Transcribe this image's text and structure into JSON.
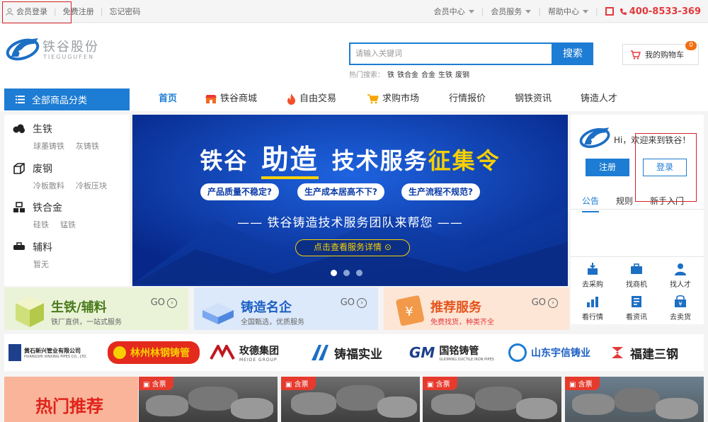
{
  "topbar": {
    "login": "会员登录",
    "register": "免费注册",
    "forgot": "忘记密码",
    "member_center": "会员中心",
    "member_service": "会员服务",
    "help_center": "帮助中心",
    "phone": "400-8533-369"
  },
  "header": {
    "logo_cn": "铁谷股份",
    "logo_en": "TIEGUGUFEN",
    "search_placeholder": "请输入关键词",
    "search_button": "搜索",
    "hot_label": "热门搜索：",
    "hot_keywords": [
      "铁",
      "铁合金",
      "合金",
      "生铁",
      "废钢"
    ],
    "cart_label": "我的购物车",
    "cart_count": "0"
  },
  "nav": {
    "all_categories": "全部商品分类",
    "items": [
      "首页",
      "铁谷商城",
      "自由交易",
      "求购市场",
      "行情报价",
      "钢铁资讯",
      "铸造人才"
    ]
  },
  "categories": [
    {
      "title": "生铁",
      "subs": [
        "球墨铸铁",
        "灰铸铁"
      ]
    },
    {
      "title": "废钢",
      "subs": [
        "冷板散料",
        "冷板压块"
      ]
    },
    {
      "title": "铁合金",
      "subs": [
        "硅铁",
        "锰铁"
      ]
    },
    {
      "title": "辅料",
      "subs": [
        "暂无"
      ]
    }
  ],
  "banner": {
    "title_a": "铁谷",
    "title_b": "助造",
    "title_c": "技术服务",
    "title_d": "征集令",
    "pills": [
      "产品质量不稳定?",
      "生产成本居高不下?",
      "生产流程不规范?"
    ],
    "subtitle": "—— 铁谷铸造技术服务团队来帮您 ——",
    "button": "点击查看服务详情"
  },
  "user_panel": {
    "greeting": "Hi，欢迎来到铁谷！",
    "register": "注册",
    "login": "登录",
    "tabs": [
      "公告",
      "规则",
      "新手入门"
    ]
  },
  "quick_links": [
    "去采购",
    "找商机",
    "找人才",
    "看行情",
    "看资讯",
    "去卖货"
  ],
  "promos": [
    {
      "title": "生铁/辅料",
      "sub": "铁厂直供，一站式服务",
      "go": "GO"
    },
    {
      "title": "铸造名企",
      "sub": "全国甄选，优质服务",
      "go": "GO"
    },
    {
      "title": "推荐服务",
      "sub": "免费找货，种类齐全",
      "go": "GO"
    }
  ],
  "brands": [
    {
      "name": "黄石新兴管业有限公司",
      "sub": "HUANGSHI XINXING PIPES CO., LTD."
    },
    {
      "name": "林州林钢铸管",
      "sub": ""
    },
    {
      "name": "玫德集团",
      "sub": "MEIDE GROUP"
    },
    {
      "name": "铸福实业",
      "sub": ""
    },
    {
      "name": "国铭铸管",
      "sub": "GUOMING DUCTILE IRON PIPES"
    },
    {
      "name": "山东宇信铸业",
      "sub": ""
    },
    {
      "name": "福建三钢",
      "sub": ""
    }
  ],
  "bottom": {
    "hot_title": "热门推荐",
    "tag": "含票"
  },
  "colors": {
    "brand_blue": "#1d7cd3",
    "accent_red": "#e4393c",
    "banner_blue": "#0a3aa8",
    "banner_yellow": "#f7d000"
  }
}
